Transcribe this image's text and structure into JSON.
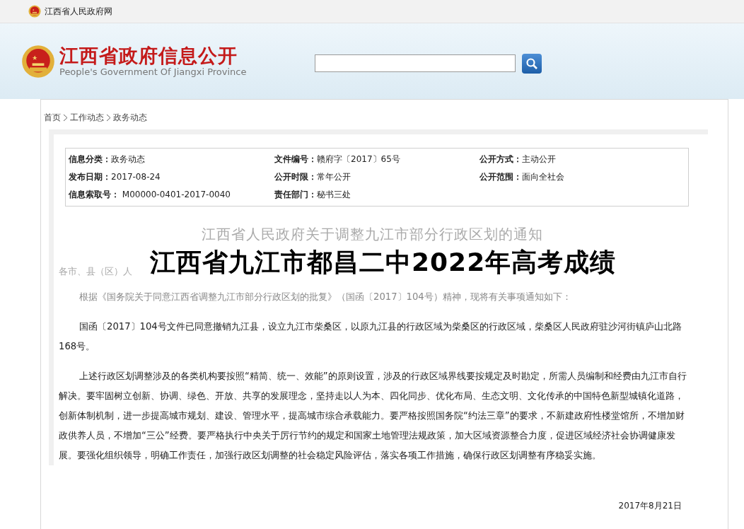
{
  "topbar": {
    "site_name": "江西省人民政府网"
  },
  "header": {
    "logo_title": "江西省政府信息公开",
    "logo_subtitle": "People's Government Of Jiangxi Province"
  },
  "breadcrumb": [
    "首页",
    "工作动态",
    "政务动态"
  ],
  "info": [
    {
      "label": "信息分类：",
      "value": "政务动态"
    },
    {
      "label": "文件编号：",
      "value": "赣府字〔2017〕65号"
    },
    {
      "label": "公开方式：",
      "value": "主动公开"
    },
    {
      "label": "发布日期：",
      "value": "2017-08-24"
    },
    {
      "label": "公开时限：",
      "value": "常年公开"
    },
    {
      "label": "公开范围：",
      "value": "面向全社会"
    },
    {
      "label": "信息索取号：",
      "value": " M00000-0401-2017-0040"
    },
    {
      "label": "责任部门：",
      "value": "秘书三处"
    }
  ],
  "article": {
    "title": "江西省人民政府关于调整九江市部分行政区划的通知",
    "salutation": "各市、县（区）人",
    "paragraphs": [
      "根据《国务院关于同意江西省调整九江市部分行政区划的批复》（国函〔2017〕104号）精神，现将有关事项通知如下：",
      "国函〔2017〕104号文件已同意撤销九江县，设立九江市柴桑区，以原九江县的行政区域为柴桑区的行政区域，柴桑区人民政府驻沙河街镇庐山北路168号。",
      "上述行政区划调整涉及的各类机构要按照“精简、统一、效能”的原则设置，涉及的行政区域界线要按规定及时勘定，所需人员编制和经费由九江市自行解决。要牢固树立创新、协调、绿色、开放、共享的发展理念，坚持走以人为本、四化同步、优化布局、生态文明、文化传承的中国特色新型城镇化道路，创新体制机制，进一步提高城市规划、建设、管理水平，提高城市综合承载能力。要严格按照国务院“约法三章”的要求，不新建政府性楼堂馆所，不增加财政供养人员，不增加“三公”经费。要严格执行中央关于厉行节约的规定和国家土地管理法规政策，加大区域资源整合力度，促进区域经济社会协调健康发展。要强化组织领导，明确工作责任，加强行政区划调整的社会稳定风险评估，落实各项工作措施，确保行政区划调整有序稳妥实施。"
    ],
    "date": "2017年8月21日"
  },
  "overlay_banner": {
    "text": "江西省九江市都昌二中2022年高考成绩"
  }
}
